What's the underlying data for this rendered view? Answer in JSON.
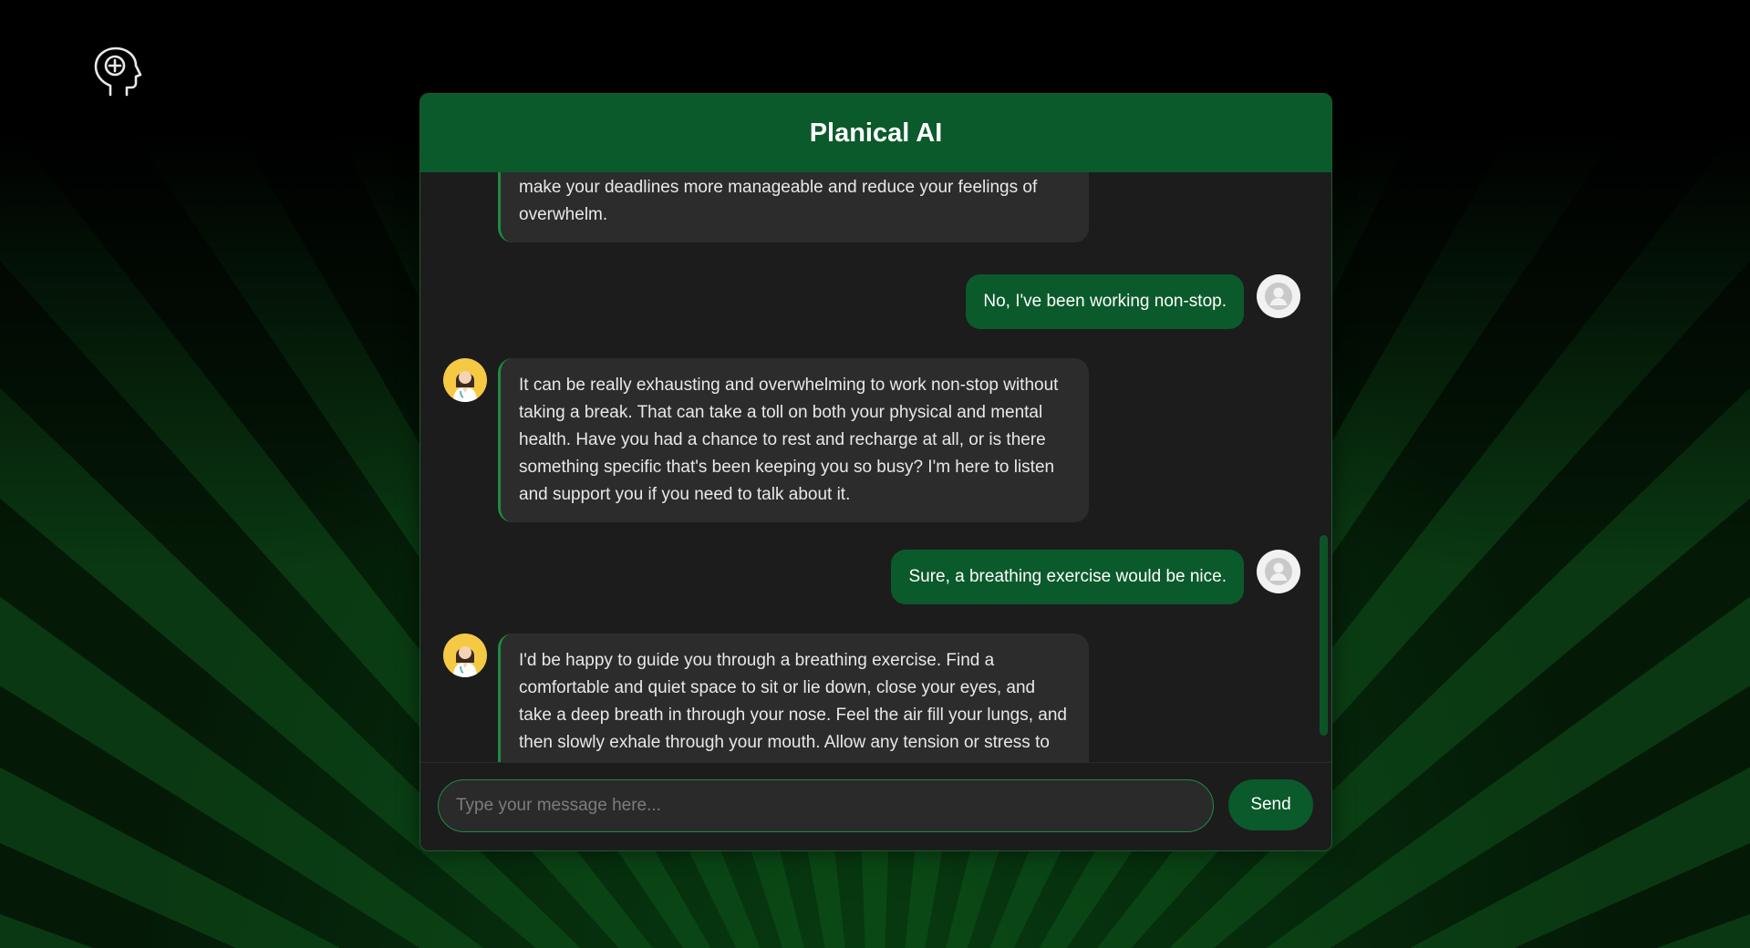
{
  "header": {
    "title": "Planical AI"
  },
  "logo": {
    "icon": "head-plus-icon"
  },
  "messages": [
    {
      "role": "bot",
      "text": "make your deadlines more manageable and reduce your feelings of overwhelm."
    },
    {
      "role": "user",
      "text": "No, I've been working non-stop."
    },
    {
      "role": "bot",
      "text": "It can be really exhausting and overwhelming to work non-stop without taking a break. That can take a toll on both your physical and mental health. Have you had a chance to rest and recharge at all, or is there something specific that's been keeping you so busy? I'm here to listen and support you if you need to talk about it."
    },
    {
      "role": "user",
      "text": "Sure, a breathing exercise would be nice."
    },
    {
      "role": "bot",
      "text": "I'd be happy to guide you through a breathing exercise. Find a comfortable and quiet space to sit or lie down, close your eyes, and take a deep breath in through your nose. Feel the air fill your lungs, and then slowly exhale through your mouth. Allow any tension or stress to release"
    }
  ],
  "composer": {
    "placeholder": "Type your message here...",
    "send_label": "Send"
  },
  "colors": {
    "accent": "#0b5a2b",
    "bubble_bot": "#2c2c2c",
    "bubble_border": "#1d8c3e",
    "bot_avatar": "#f6c945"
  }
}
